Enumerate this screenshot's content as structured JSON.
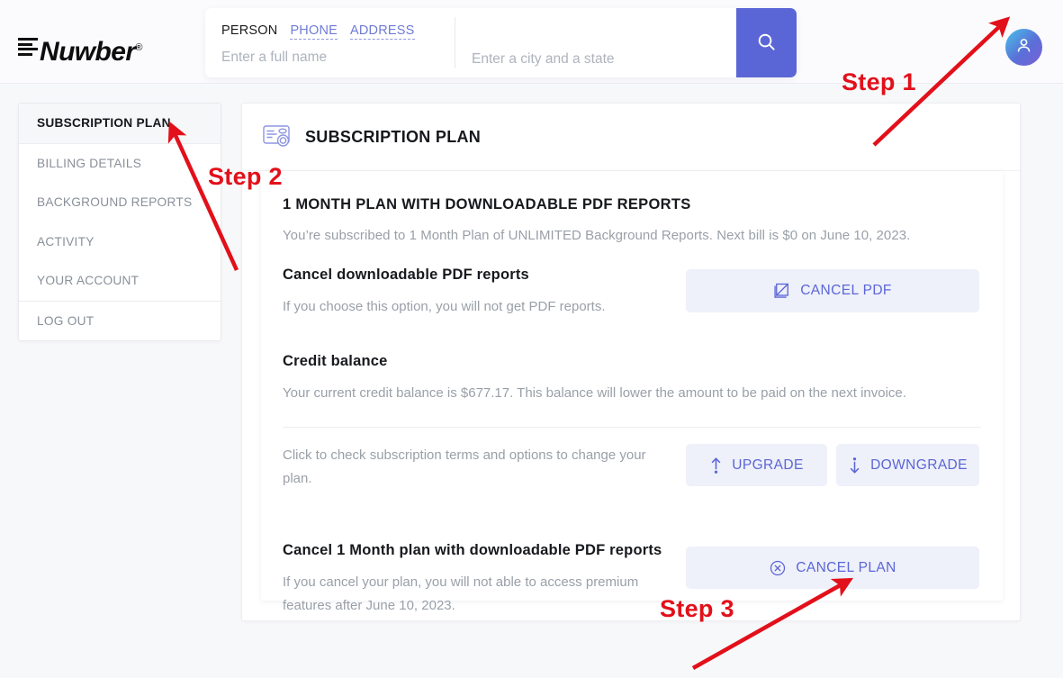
{
  "brand": {
    "name": "Nuwber",
    "registered": "®"
  },
  "search": {
    "tabs": [
      {
        "label": "PERSON",
        "active": true
      },
      {
        "label": "PHONE",
        "active": false
      },
      {
        "label": "ADDRESS",
        "active": false
      }
    ],
    "name_placeholder": "Enter a full name",
    "name_value": "",
    "location_placeholder": "Enter a city and a state",
    "location_value": "",
    "search_icon": "search-icon",
    "button_color": "#5b66d6"
  },
  "account": {
    "avatar_icon": "user-avatar-icon"
  },
  "sidebar": {
    "items": [
      {
        "label": "SUBSCRIPTION PLAN",
        "active": true
      },
      {
        "label": "BILLING DETAILS",
        "active": false
      },
      {
        "label": "BACKGROUND REPORTS",
        "active": false
      },
      {
        "label": "ACTIVITY",
        "active": false
      },
      {
        "label": "YOUR ACCOUNT",
        "active": false
      },
      {
        "label": "LOG OUT",
        "active": false
      }
    ]
  },
  "main": {
    "header_icon": "subscription-card-icon",
    "header_title": "SUBSCRIPTION PLAN",
    "plan_title": "1 MONTH PLAN WITH DOWNLOADABLE PDF REPORTS",
    "plan_description": "You’re subscribed to 1 Month Plan of UNLIMITED Background Reports. Next bill is $0 on June 10, 2023.",
    "sections": [
      {
        "heading": "Cancel downloadable PDF reports",
        "text": "If you choose this option, you will not get PDF reports.",
        "button": {
          "label": "CANCEL PDF",
          "icon": "cancel-pdf-icon"
        }
      },
      {
        "heading": "Credit balance",
        "text": "Your current credit balance is $677.17. This balance will lower the amount to be paid on the next invoice."
      },
      {
        "heading": "",
        "text": "Click to check subscription terms and options to change your plan.",
        "buttons": [
          {
            "label": "UPGRADE",
            "icon": "arrow-up-icon"
          },
          {
            "label": "DOWNGRADE",
            "icon": "arrow-down-icon"
          }
        ]
      },
      {
        "heading": "Cancel 1 Month plan with downloadable PDF reports",
        "text": "If you cancel your plan, you will not able to access premium features after June 10, 2023.",
        "button": {
          "label": "CANCEL PLAN",
          "icon": "circle-x-icon"
        }
      }
    ]
  },
  "annotations": {
    "color": "#e2101a",
    "steps": [
      {
        "label": "Step 1"
      },
      {
        "label": "Step 2"
      },
      {
        "label": "Step 3"
      }
    ]
  }
}
